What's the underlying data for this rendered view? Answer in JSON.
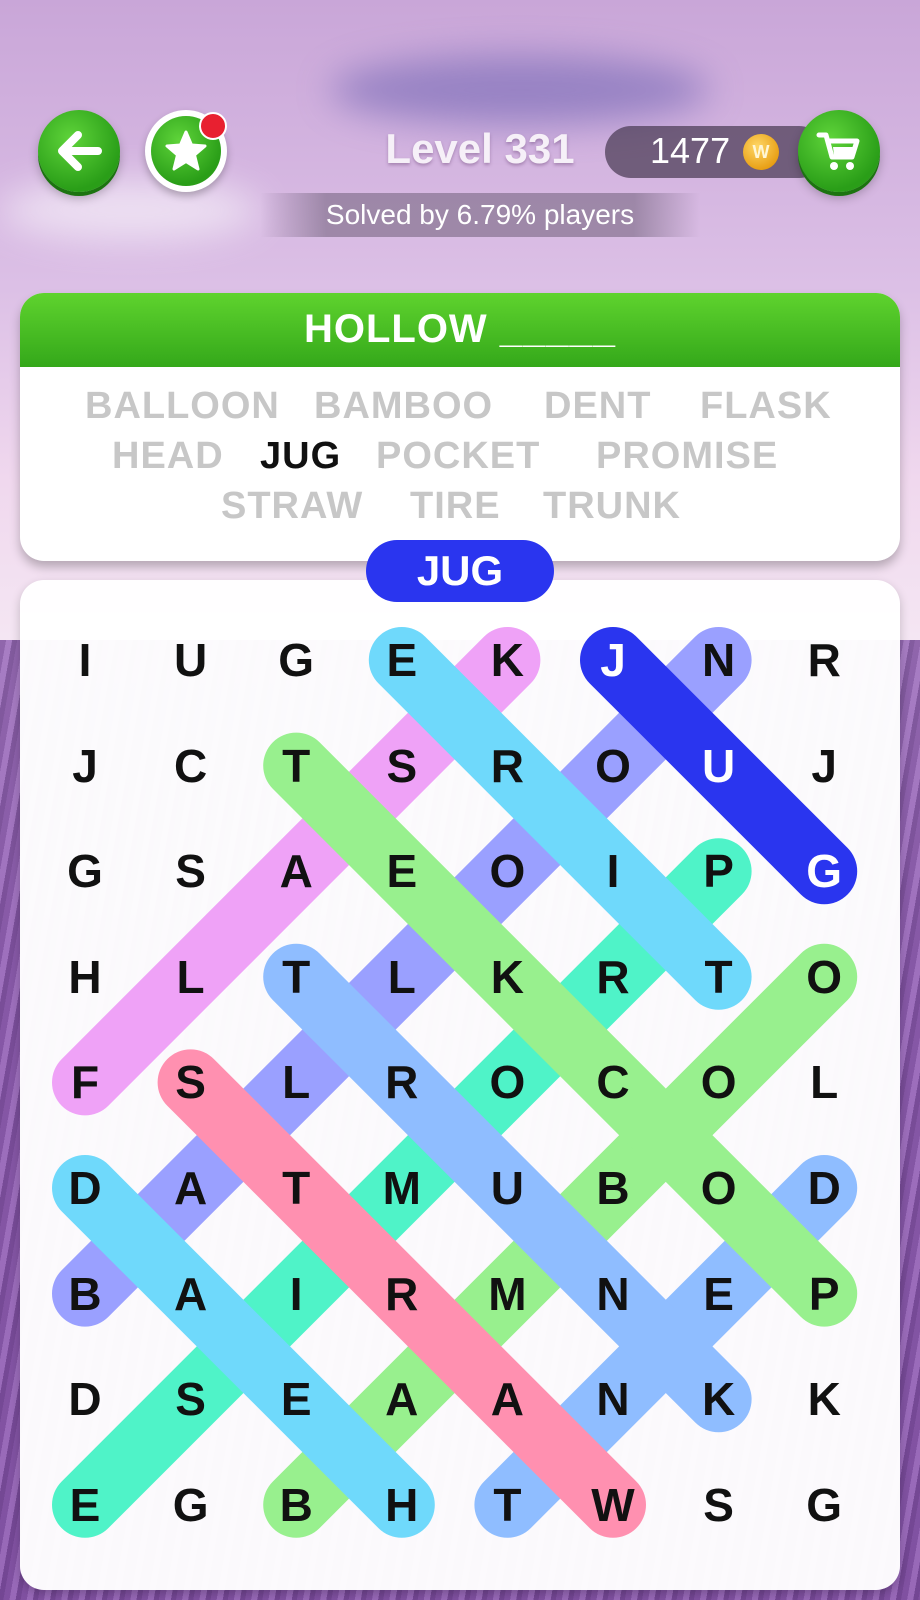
{
  "header": {
    "level_title": "Level 331",
    "coins": "1477",
    "coin_symbol": "W",
    "solved_text": "Solved by 6.79% players"
  },
  "category": "HOLLOW _____",
  "words": [
    {
      "text": "BALLOON",
      "found": false
    },
    {
      "text": "BAMBOO",
      "found": false
    },
    {
      "text": "DENT",
      "found": false
    },
    {
      "text": "FLASK",
      "found": false
    },
    {
      "text": "HEAD",
      "found": false
    },
    {
      "text": "JUG",
      "found": true
    },
    {
      "text": "POCKET",
      "found": false
    },
    {
      "text": "PROMISE",
      "found": false
    },
    {
      "text": "STRAW",
      "found": false
    },
    {
      "text": "TIRE",
      "found": false
    },
    {
      "text": "TRUNK",
      "found": false
    }
  ],
  "current_word": "JUG",
  "grid": [
    [
      "I",
      "U",
      "G",
      "E",
      "K",
      "J",
      "N",
      "R"
    ],
    [
      "J",
      "C",
      "T",
      "S",
      "R",
      "O",
      "U",
      "J"
    ],
    [
      "G",
      "S",
      "A",
      "E",
      "O",
      "I",
      "P",
      "G"
    ],
    [
      "H",
      "L",
      "T",
      "L",
      "K",
      "R",
      "T",
      "O"
    ],
    [
      "F",
      "S",
      "L",
      "R",
      "O",
      "C",
      "O",
      "L"
    ],
    [
      "D",
      "A",
      "T",
      "M",
      "U",
      "B",
      "O",
      "D"
    ],
    [
      "B",
      "A",
      "I",
      "R",
      "M",
      "N",
      "E",
      "P"
    ],
    [
      "D",
      "S",
      "E",
      "A",
      "A",
      "N",
      "K",
      "K"
    ],
    [
      "E",
      "G",
      "B",
      "H",
      "T",
      "W",
      "S",
      "G"
    ]
  ],
  "highlights": [
    {
      "color": "#9aa0ff",
      "from": [
        0,
        6
      ],
      "to": [
        6,
        0
      ]
    },
    {
      "color": "#4ff3c8",
      "from": [
        2,
        6
      ],
      "to": [
        8,
        0
      ]
    },
    {
      "color": "#98f08e",
      "from": [
        3,
        7
      ],
      "to": [
        8,
        2
      ]
    },
    {
      "color": "#8fbdff",
      "from": [
        5,
        7
      ],
      "to": [
        8,
        4
      ]
    },
    {
      "color": "#efa2f7",
      "from": [
        0,
        4
      ],
      "to": [
        4,
        0
      ]
    },
    {
      "color": "#98f08e",
      "from": [
        1,
        2
      ],
      "to": [
        6,
        7
      ]
    },
    {
      "color": "#8fbdff",
      "from": [
        3,
        2
      ],
      "to": [
        7,
        6
      ]
    },
    {
      "color": "#6fd9fb",
      "from": [
        0,
        3
      ],
      "to": [
        3,
        6
      ]
    },
    {
      "color": "#6fd9fb",
      "from": [
        5,
        0
      ],
      "to": [
        8,
        3
      ]
    },
    {
      "color": "#ff90b0",
      "from": [
        4,
        1
      ],
      "to": [
        8,
        5
      ]
    },
    {
      "color": "#2a35ef",
      "from": [
        0,
        5
      ],
      "to": [
        2,
        7
      ]
    }
  ],
  "dark_cells": [
    [
      0,
      5
    ],
    [
      1,
      6
    ],
    [
      2,
      7
    ]
  ]
}
